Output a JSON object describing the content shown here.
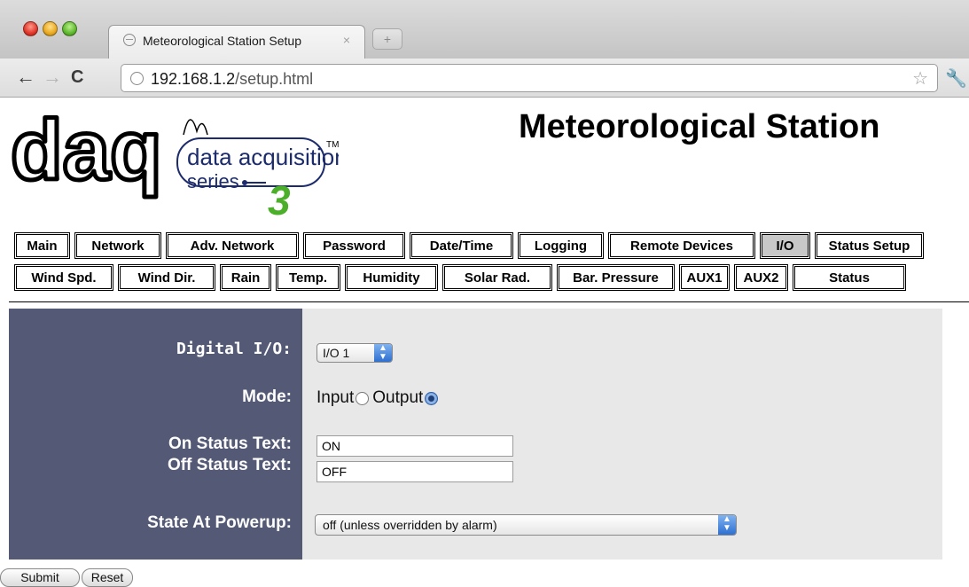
{
  "browser": {
    "tab_title": "Meteorological Station Setup",
    "tab_close": "×",
    "new_tab": "+",
    "url_host": "192.168.1.2",
    "url_path": "/setup.html",
    "icons": {
      "back": "back-arrow-icon",
      "forward": "forward-arrow-icon",
      "reload": "reload-icon",
      "star": "star-icon",
      "wrench": "wrench-icon"
    }
  },
  "header": {
    "title": "Meteorological Station",
    "logo": {
      "big_text": "daq",
      "line1": "data acquisition",
      "line2": "series",
      "tm": "TM",
      "numeral": "3"
    }
  },
  "nav": {
    "row1": [
      {
        "label": "Main",
        "active": false
      },
      {
        "label": "Network",
        "active": false
      },
      {
        "label": "Adv. Network",
        "active": false
      },
      {
        "label": "Password",
        "active": false
      },
      {
        "label": "Date/Time",
        "active": false
      },
      {
        "label": "Logging",
        "active": false
      },
      {
        "label": "Remote Devices",
        "active": false
      },
      {
        "label": "I/O",
        "active": true
      },
      {
        "label": "Status Setup",
        "active": false
      }
    ],
    "row2": [
      {
        "label": "Wind Spd.",
        "active": false
      },
      {
        "label": "Wind Dir.",
        "active": false
      },
      {
        "label": "Rain",
        "active": false
      },
      {
        "label": "Temp.",
        "active": false
      },
      {
        "label": "Humidity",
        "active": false
      },
      {
        "label": "Solar Rad.",
        "active": false
      },
      {
        "label": "Bar. Pressure",
        "active": false
      },
      {
        "label": "AUX1",
        "active": false
      },
      {
        "label": "AUX2",
        "active": false
      },
      {
        "label": "Status",
        "active": false
      }
    ]
  },
  "form": {
    "digital_io": {
      "label": "Digital I/O:",
      "value": "I/O 1"
    },
    "mode": {
      "label": "Mode:",
      "option_input": "Input",
      "option_output": "Output",
      "selected": "Output"
    },
    "on_status": {
      "label": "On Status Text:",
      "value": "ON"
    },
    "off_status": {
      "label": "Off Status Text:",
      "value": "OFF"
    },
    "powerup": {
      "label": "State At Powerup:",
      "value": "off (unless overridden by alarm)"
    }
  },
  "buttons": {
    "submit": "Submit",
    "reset": "Reset"
  },
  "colors": {
    "label_panel": "#545a76",
    "field_panel": "#e8e8e8",
    "active_tab": "#c8c8c8",
    "logo_green": "#4caf2a"
  }
}
